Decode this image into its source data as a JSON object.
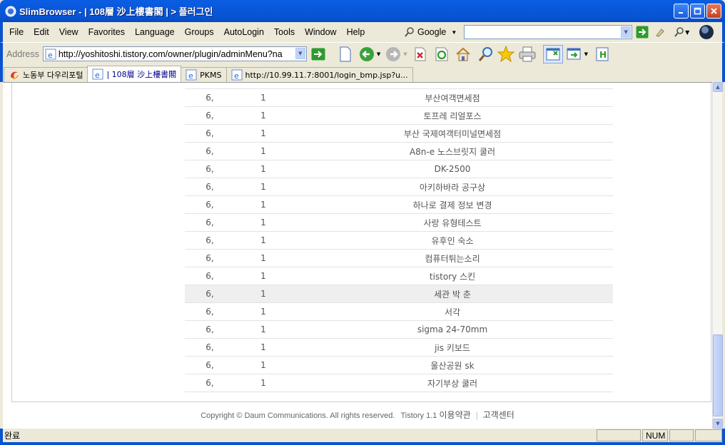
{
  "window": {
    "title": "SlimBrowser - | 108層 沙上樓書閣 | > 플러그인",
    "colors": {
      "title_bar": "#0a58d9",
      "chrome": "#ece9d8"
    }
  },
  "menu": {
    "items": [
      "File",
      "Edit",
      "View",
      "Favorites",
      "Language",
      "Groups",
      "AutoLogin",
      "Tools",
      "Window",
      "Help"
    ],
    "search_engine": "Google",
    "search_value": ""
  },
  "address": {
    "label": "Address",
    "url": "http://yoshitoshi.tistory.com/owner/plugin/adminMenu?na"
  },
  "tabs": [
    {
      "label": "노동부 다우리포털",
      "icon": "favicon-icon",
      "active": false
    },
    {
      "label": "| 108層 沙上樓書閣",
      "icon": "ie-page-icon",
      "active": true
    },
    {
      "label": "PKMS",
      "icon": "ie-page-icon",
      "active": false
    },
    {
      "label": "http://10.99.11.7:8001/login_bmp.jsp?u...",
      "icon": "ie-page-icon",
      "active": false
    }
  ],
  "table": {
    "rows": [
      {
        "col1": "6,",
        "col2": "1",
        "title": "부산여객면세점"
      },
      {
        "col1": "6,",
        "col2": "1",
        "title": "토프레 리얼포스"
      },
      {
        "col1": "6,",
        "col2": "1",
        "title": "부산 국제여객터미널면세점"
      },
      {
        "col1": "6,",
        "col2": "1",
        "title": "A8n-e 노스브릿지 쿨러"
      },
      {
        "col1": "6,",
        "col2": "1",
        "title": "DK-2500"
      },
      {
        "col1": "6,",
        "col2": "1",
        "title": "아키하바라 공구상"
      },
      {
        "col1": "6,",
        "col2": "1",
        "title": "하나로 결제 정보 변경"
      },
      {
        "col1": "6,",
        "col2": "1",
        "title": "사랑 유형테스트"
      },
      {
        "col1": "6,",
        "col2": "1",
        "title": "유후인 숙소"
      },
      {
        "col1": "6,",
        "col2": "1",
        "title": "컴퓨터튀는소리"
      },
      {
        "col1": "6,",
        "col2": "1",
        "title": "tistory 스킨"
      },
      {
        "col1": "6,",
        "col2": "1",
        "title": "세관 박 춘"
      },
      {
        "col1": "6,",
        "col2": "1",
        "title": "서각"
      },
      {
        "col1": "6,",
        "col2": "1",
        "title": "sigma 24-70mm"
      },
      {
        "col1": "6,",
        "col2": "1",
        "title": "jis 키보드"
      },
      {
        "col1": "6,",
        "col2": "1",
        "title": "울산공원 sk"
      },
      {
        "col1": "6,",
        "col2": "1",
        "title": "자기부상 쿨러"
      }
    ]
  },
  "footer": {
    "copyright": "Copyright © Daum Communications. All rights reserved.",
    "version": "Tistory 1.1",
    "terms": "이용약관",
    "support": "고객센터"
  },
  "status": {
    "text": "완료",
    "num": "NUM"
  }
}
